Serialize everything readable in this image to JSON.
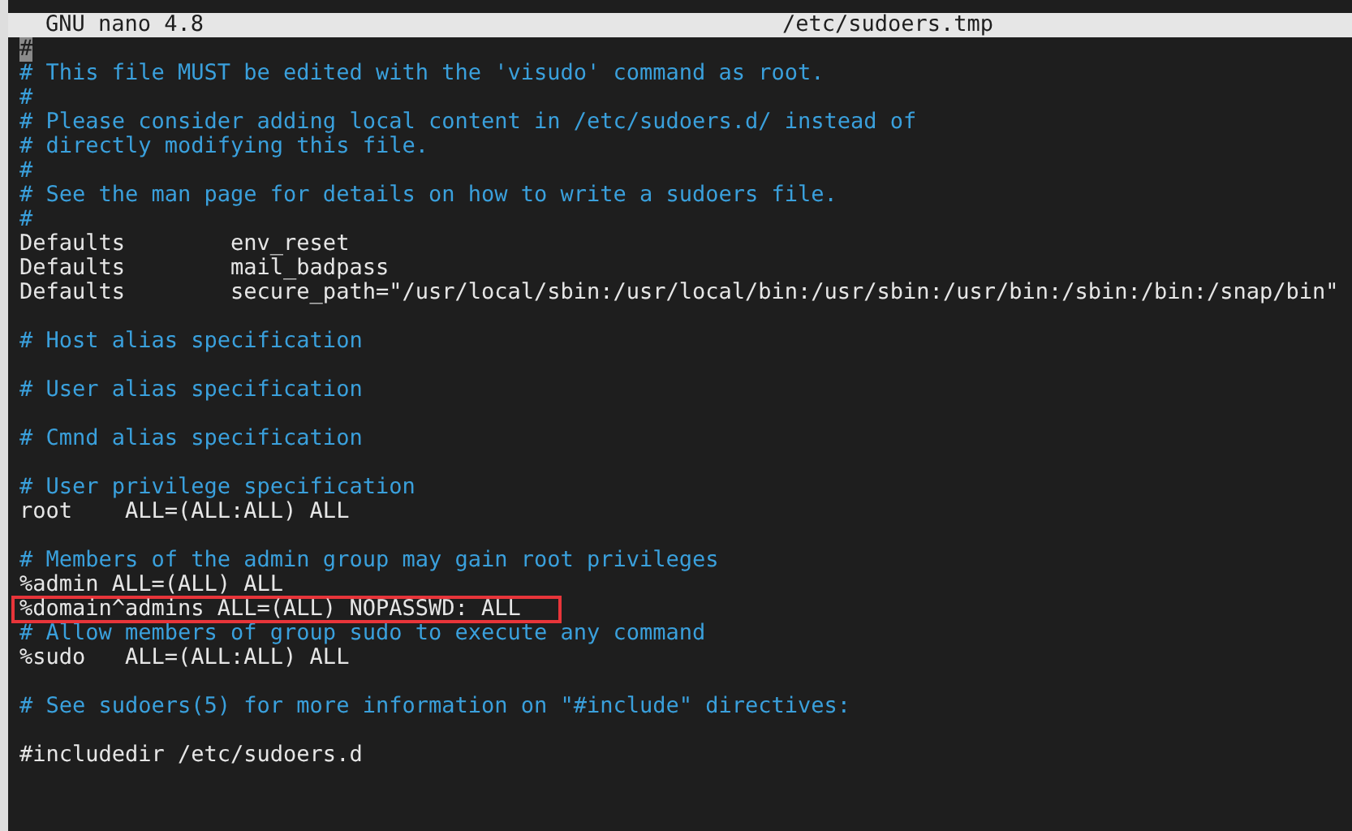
{
  "title_bar": {
    "app": "GNU nano 4.8",
    "file": "/etc/sudoers.tmp"
  },
  "lines": [
    {
      "kind": "comment",
      "text": "#",
      "cursor": true,
      "highlighted": false
    },
    {
      "kind": "comment",
      "text": "# This file MUST be edited with the 'visudo' command as root.",
      "cursor": false,
      "highlighted": false
    },
    {
      "kind": "comment",
      "text": "#",
      "cursor": false,
      "highlighted": false
    },
    {
      "kind": "comment",
      "text": "# Please consider adding local content in /etc/sudoers.d/ instead of",
      "cursor": false,
      "highlighted": false
    },
    {
      "kind": "comment",
      "text": "# directly modifying this file.",
      "cursor": false,
      "highlighted": false
    },
    {
      "kind": "comment",
      "text": "#",
      "cursor": false,
      "highlighted": false
    },
    {
      "kind": "comment",
      "text": "# See the man page for details on how to write a sudoers file.",
      "cursor": false,
      "highlighted": false
    },
    {
      "kind": "comment",
      "text": "#",
      "cursor": false,
      "highlighted": false
    },
    {
      "kind": "code",
      "text": "Defaults        env_reset",
      "cursor": false,
      "highlighted": false
    },
    {
      "kind": "code",
      "text": "Defaults        mail_badpass",
      "cursor": false,
      "highlighted": false
    },
    {
      "kind": "code",
      "text": "Defaults        secure_path=\"/usr/local/sbin:/usr/local/bin:/usr/sbin:/usr/bin:/sbin:/bin:/snap/bin\"",
      "cursor": false,
      "highlighted": false
    },
    {
      "kind": "blank"
    },
    {
      "kind": "comment",
      "text": "# Host alias specification",
      "cursor": false,
      "highlighted": false
    },
    {
      "kind": "blank"
    },
    {
      "kind": "comment",
      "text": "# User alias specification",
      "cursor": false,
      "highlighted": false
    },
    {
      "kind": "blank"
    },
    {
      "kind": "comment",
      "text": "# Cmnd alias specification",
      "cursor": false,
      "highlighted": false
    },
    {
      "kind": "blank"
    },
    {
      "kind": "comment",
      "text": "# User privilege specification",
      "cursor": false,
      "highlighted": false
    },
    {
      "kind": "code",
      "text": "root    ALL=(ALL:ALL) ALL",
      "cursor": false,
      "highlighted": false
    },
    {
      "kind": "blank"
    },
    {
      "kind": "comment",
      "text": "# Members of the admin group may gain root privileges",
      "cursor": false,
      "highlighted": false
    },
    {
      "kind": "code",
      "text": "%admin ALL=(ALL) ALL",
      "cursor": false,
      "highlighted": false
    },
    {
      "kind": "code",
      "text": "%domain^admins ALL=(ALL) NOPASSWD: ALL",
      "cursor": false,
      "highlighted": true
    },
    {
      "kind": "comment",
      "text": "# Allow members of group sudo to execute any command",
      "cursor": false,
      "highlighted": false
    },
    {
      "kind": "code",
      "text": "%sudo   ALL=(ALL:ALL) ALL",
      "cursor": false,
      "highlighted": false
    },
    {
      "kind": "blank"
    },
    {
      "kind": "comment",
      "text": "# See sudoers(5) for more information on \"#include\" directives:",
      "cursor": false,
      "highlighted": false
    },
    {
      "kind": "blank"
    },
    {
      "kind": "code",
      "text": "#includedir /etc/sudoers.d",
      "cursor": false,
      "highlighted": false
    }
  ]
}
